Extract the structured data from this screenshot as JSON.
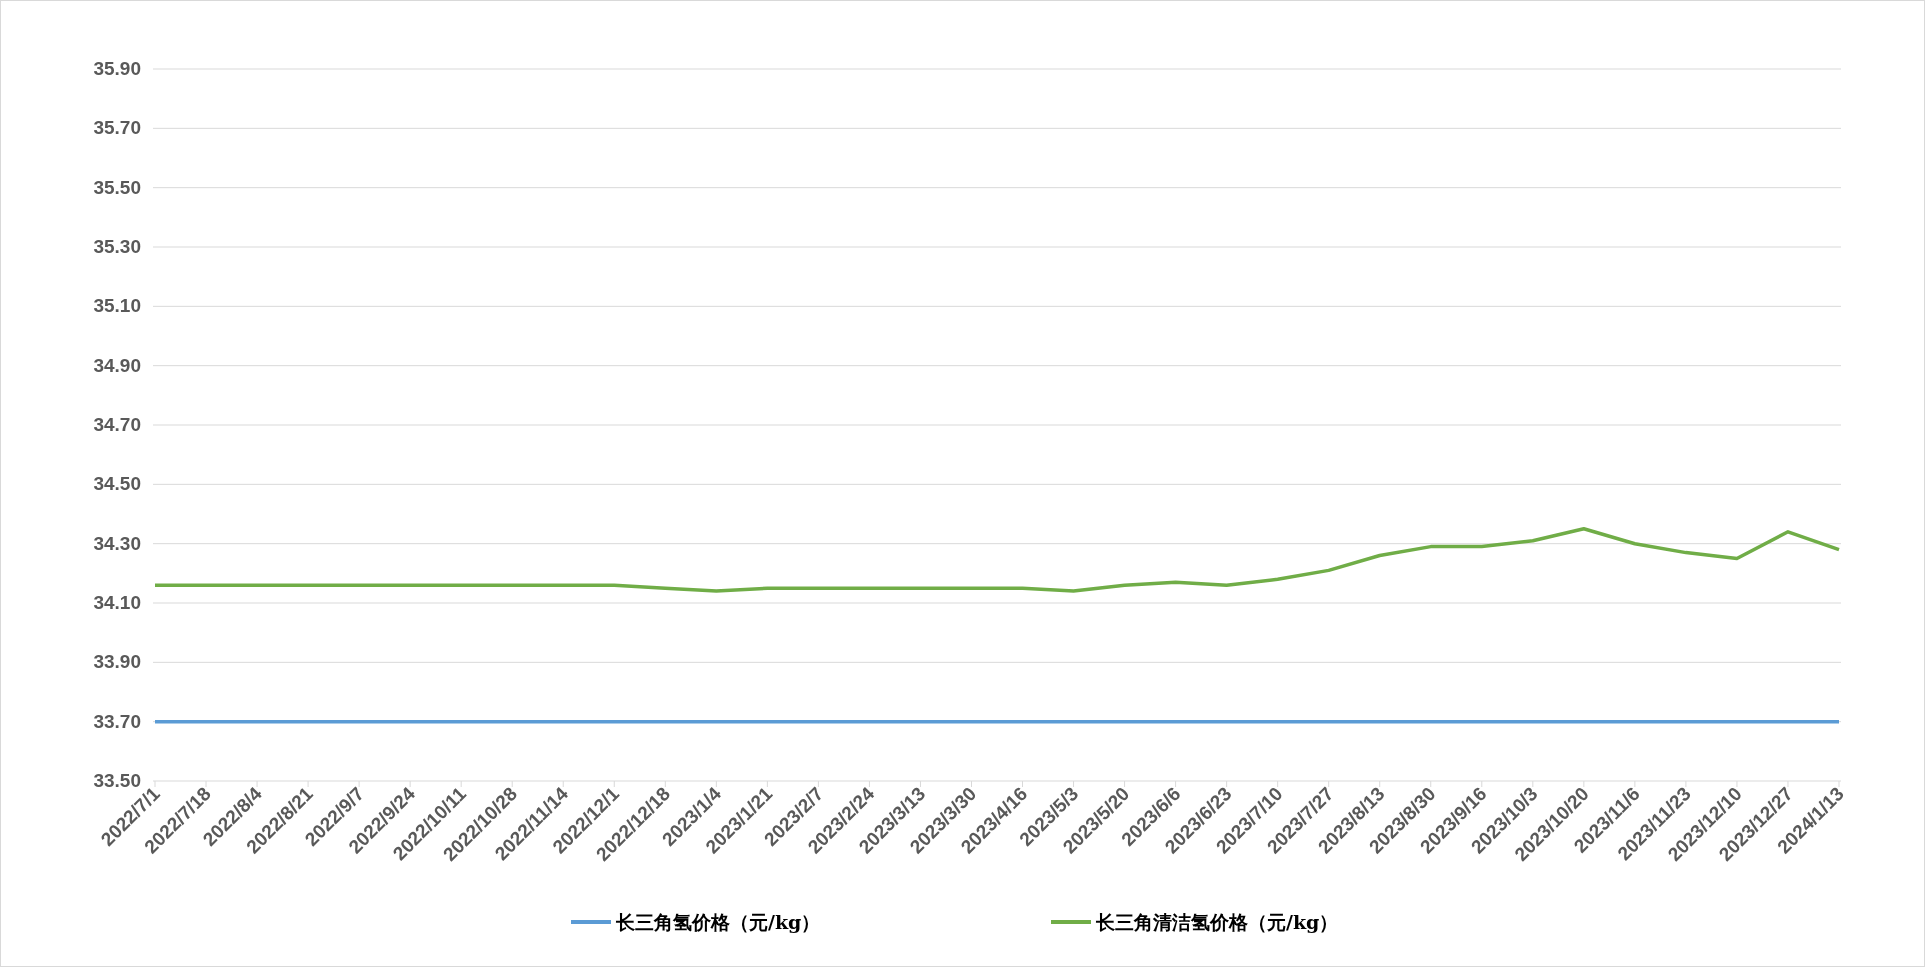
{
  "chart_data": {
    "type": "line",
    "categories": [
      "2022/7/1",
      "2022/7/18",
      "2022/8/4",
      "2022/8/21",
      "2022/9/7",
      "2022/9/24",
      "2022/10/11",
      "2022/10/28",
      "2022/11/14",
      "2022/12/1",
      "2022/12/18",
      "2023/1/4",
      "2023/1/21",
      "2023/2/7",
      "2023/2/24",
      "2023/3/13",
      "2023/3/30",
      "2023/4/16",
      "2023/5/3",
      "2023/5/20",
      "2023/6/6",
      "2023/6/23",
      "2023/7/10",
      "2023/7/27",
      "2023/8/13",
      "2023/8/30",
      "2023/9/16",
      "2023/10/3",
      "2023/10/20",
      "2023/11/6",
      "2023/11/23",
      "2023/12/10",
      "2023/12/27",
      "2024/1/13"
    ],
    "series": [
      {
        "name": "长三角氢价格（元/kg）",
        "color": "#5b9bd5",
        "values": [
          33.7,
          33.7,
          33.7,
          33.7,
          33.7,
          33.7,
          33.7,
          33.7,
          33.7,
          33.7,
          33.7,
          33.7,
          33.7,
          33.7,
          33.7,
          33.7,
          33.7,
          33.7,
          33.7,
          33.7,
          33.7,
          33.7,
          33.7,
          33.7,
          33.7,
          33.7,
          33.7,
          33.7,
          33.7,
          33.7,
          33.7,
          33.7,
          33.7,
          33.7
        ]
      },
      {
        "name": "长三角清洁氢价格（元/kg）",
        "color": "#70ad47",
        "values": [
          34.16,
          34.16,
          34.16,
          34.16,
          34.16,
          34.16,
          34.16,
          34.16,
          34.16,
          34.16,
          34.15,
          34.14,
          34.15,
          34.15,
          34.15,
          34.15,
          34.15,
          34.15,
          34.14,
          34.16,
          34.17,
          34.16,
          34.18,
          34.21,
          34.26,
          34.29,
          34.29,
          34.31,
          34.35,
          34.3,
          34.27,
          34.25,
          34.34,
          34.28
        ]
      }
    ],
    "ylim": [
      33.5,
      35.9
    ],
    "grid": true,
    "legend": true,
    "yticks": [
      {
        "value": 33.5,
        "label": "33.50"
      },
      {
        "value": 33.7,
        "label": "33.70"
      },
      {
        "value": 33.9,
        "label": "33.90"
      },
      {
        "value": 34.1,
        "label": "34.10"
      },
      {
        "value": 34.3,
        "label": "34.30"
      },
      {
        "value": 34.5,
        "label": "34.50"
      },
      {
        "value": 34.7,
        "label": "34.70"
      },
      {
        "value": 34.9,
        "label": "34.90"
      },
      {
        "value": 35.1,
        "label": "35.10"
      },
      {
        "value": 35.3,
        "label": "35.30"
      },
      {
        "value": 35.5,
        "label": "35.50"
      },
      {
        "value": 35.7,
        "label": "35.70"
      },
      {
        "value": 35.9,
        "label": "35.90"
      }
    ]
  }
}
